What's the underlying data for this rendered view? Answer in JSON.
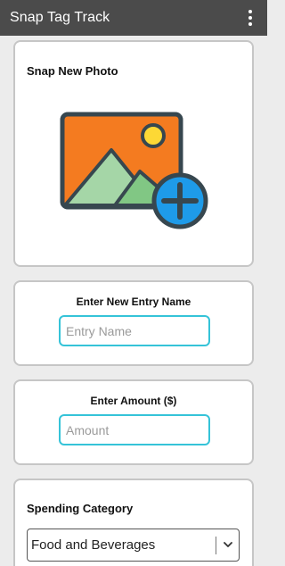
{
  "app": {
    "title": "Snap Tag Track",
    "menu_icon": "more-vert-icon"
  },
  "photo_card": {
    "title": "Snap New Photo",
    "icon": "add-photo-icon",
    "colors": {
      "frame": "#37474f",
      "sky": "#f47b20",
      "sun": "#fdd835",
      "mountain_light": "#a5d6a7",
      "mountain_dark": "#81c784",
      "plus_circle": "#1e9be9"
    }
  },
  "name_card": {
    "label": "Enter New Entry Name",
    "placeholder": "Entry Name",
    "value": ""
  },
  "amount_card": {
    "label": "Enter Amount ($)",
    "placeholder": "Amount",
    "value": ""
  },
  "category_card": {
    "title": "Spending Category",
    "selected": "Food and Beverages",
    "icon": "chevron-down-icon"
  },
  "colors": {
    "appbar": "#4b4b4b",
    "input_border": "#35c3d8",
    "background": "#ececec"
  }
}
